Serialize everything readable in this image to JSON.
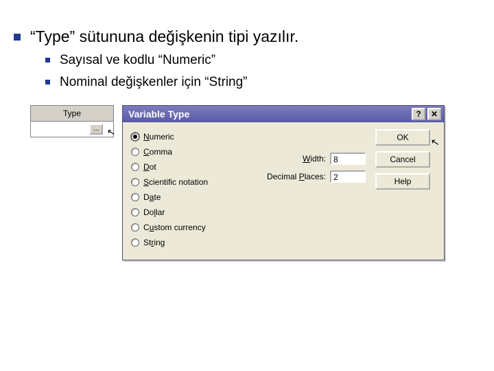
{
  "slide": {
    "main": "“Type” sütununa değişkenin tipi yazılır.",
    "sub1": "Sayısal ve kodlu “Numeric”",
    "sub2": "Nominal değişkenler için “String”"
  },
  "typecol": {
    "header": "Type",
    "ellipsis": "..."
  },
  "dialog": {
    "title": "Variable Type",
    "help_char": "?",
    "close_char": "✕",
    "radios": {
      "numeric": "Numeric",
      "comma": "Comma",
      "dot": "Dot",
      "scientific": "Scientific notation",
      "date": "Date",
      "dollar": "Dollar",
      "custom": "Custom currency",
      "string": "String"
    },
    "width_label": "Width:",
    "width_value": "8",
    "decimal_label": "Decimal Places:",
    "decimal_value": "2",
    "buttons": {
      "ok": "OK",
      "cancel": "Cancel",
      "help": "Help"
    }
  }
}
